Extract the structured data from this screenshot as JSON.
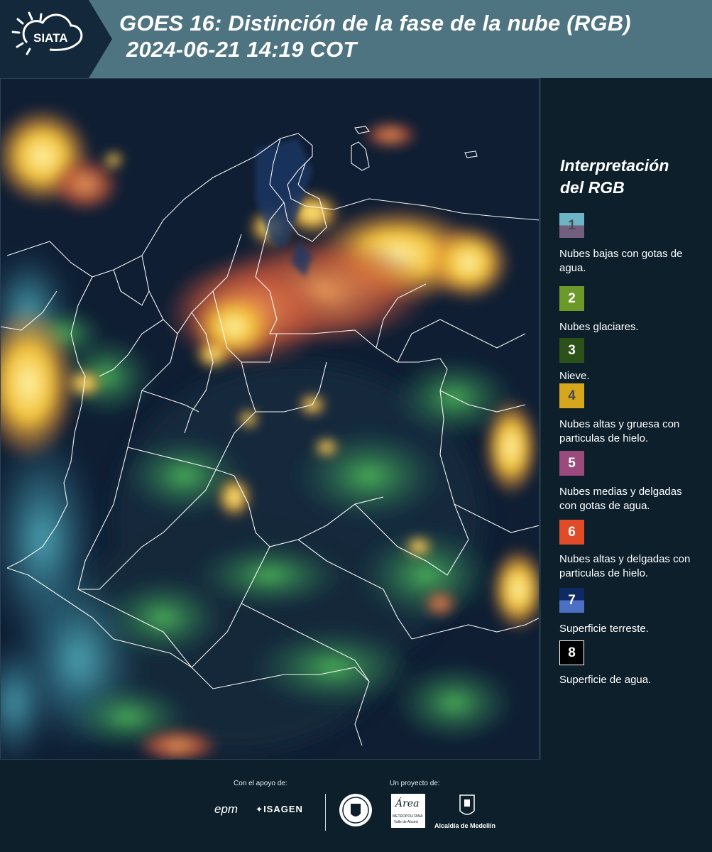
{
  "header": {
    "brand": "SIATA",
    "title_line1": "GOES 16: Distinción de la fase de la nube (RGB)",
    "title_line2": "2024-06-21 14:19 COT"
  },
  "legend": {
    "title_line1": "Interpretación",
    "title_line2": "del RGB",
    "items": [
      {
        "number": "1",
        "label": "Nubes bajas con gotas de agua.",
        "colors": [
          "#6cb4c6",
          "#725f80"
        ]
      },
      {
        "number": "2",
        "label": "Nubes glaciares.",
        "colors": [
          "#6b9a2b"
        ]
      },
      {
        "number": "3",
        "label": "Nieve.",
        "colors": [
          "#2c5219"
        ]
      },
      {
        "number": "4",
        "label": "Nubes altas y gruesa con particulas de hielo.",
        "colors": [
          "#d6a61c"
        ]
      },
      {
        "number": "5",
        "label": "Nubes medias y delgadas con gotas de agua.",
        "colors": [
          "#9a4a7c"
        ]
      },
      {
        "number": "6",
        "label": "Nubes altas y delgadas con particulas de hielo.",
        "colors": [
          "#e04c28"
        ]
      },
      {
        "number": "7",
        "label": "Superficie terreste.",
        "colors": [
          "#0f2a63",
          "#4a6fc3"
        ]
      },
      {
        "number": "8",
        "label": "Superficie de agua.",
        "colors": [
          "#000000"
        ]
      }
    ]
  },
  "footer": {
    "support_label": "Con el apoyo de:",
    "project_label": "Un proyecto de:",
    "sponsors": [
      "epm",
      "ISAGEN"
    ],
    "partners": [
      "Área Metropolitana Valle de Aburrá",
      "Alcaldía de Medellín"
    ],
    "area_logo_text": "Área",
    "area_logo_sub1": "METROPOLITANA",
    "area_logo_sub2": "Valle de Aburrá",
    "alcaldia_text": "Alcaldía de Medellín"
  },
  "colors": {
    "header_bg": "#4e7381",
    "page_bg": "#0c1f2b",
    "map_bg": "#0d1b2e",
    "cloud_yellow": "#f2c23a",
    "cloud_orange": "#e8743a",
    "vegetation_green": "#2e8f4e",
    "cyan_low_cloud": "#4bb6c8"
  }
}
